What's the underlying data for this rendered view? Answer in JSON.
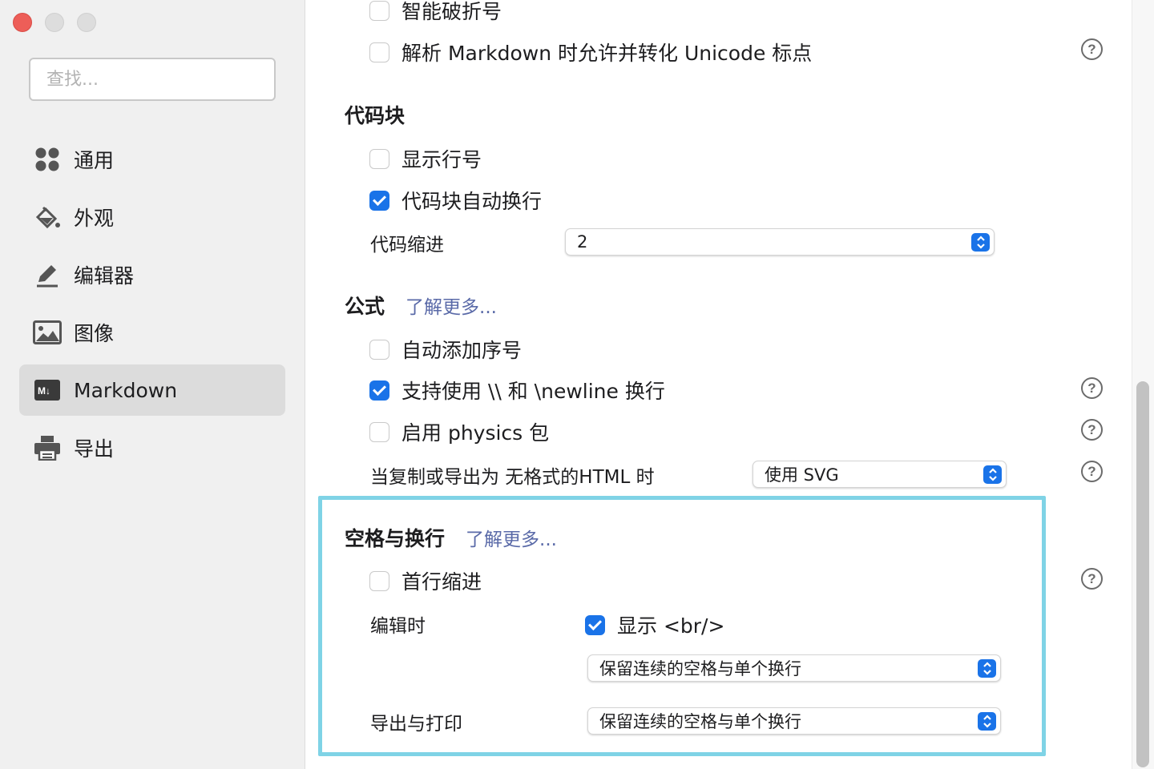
{
  "sidebar": {
    "search_placeholder": "查找...",
    "items": [
      {
        "label": "通用",
        "icon": "grid-icon"
      },
      {
        "label": "外观",
        "icon": "paint-bucket-icon"
      },
      {
        "label": "编辑器",
        "icon": "pencil-icon"
      },
      {
        "label": "图像",
        "icon": "image-icon"
      },
      {
        "label": "Markdown",
        "icon": "markdown-icon",
        "active": true
      },
      {
        "label": "导出",
        "icon": "printer-icon"
      }
    ]
  },
  "main": {
    "smart_hyphen": {
      "label": "智能破折号",
      "checked": false
    },
    "unicode_parse": {
      "label": "解析 Markdown 时允许并转化 Unicode 标点",
      "checked": false
    },
    "code_block": {
      "title": "代码块",
      "show_line_numbers": {
        "label": "显示行号",
        "checked": false
      },
      "auto_wrap": {
        "label": "代码块自动换行",
        "checked": true
      },
      "indent_label": "代码缩进",
      "indent_value": "2"
    },
    "math": {
      "title": "公式",
      "learn_more": "了解更多...",
      "auto_number": {
        "label": "自动添加序号",
        "checked": false
      },
      "newline": {
        "label": "支持使用 \\\\ 和 \\newline 换行",
        "checked": true
      },
      "physics": {
        "label": "启用 physics 包",
        "checked": true
      },
      "export_label": "当复制或导出为 无格式的HTML 时",
      "export_value": "使用 SVG"
    },
    "whitespace": {
      "title": "空格与换行",
      "learn_more": "了解更多...",
      "first_line_indent": {
        "label": "首行缩进",
        "checked": false
      },
      "editing_label": "编辑时",
      "show_br": {
        "label": "显示 <br/>",
        "checked": true
      },
      "editing_value": "保留连续的空格与单个换行",
      "export_print_label": "导出与打印",
      "export_print_value": "保留连续的空格与单个换行"
    }
  },
  "colors": {
    "accent": "#1a73e8",
    "highlight": "#7fd3e6",
    "link": "#5a6aa8"
  }
}
